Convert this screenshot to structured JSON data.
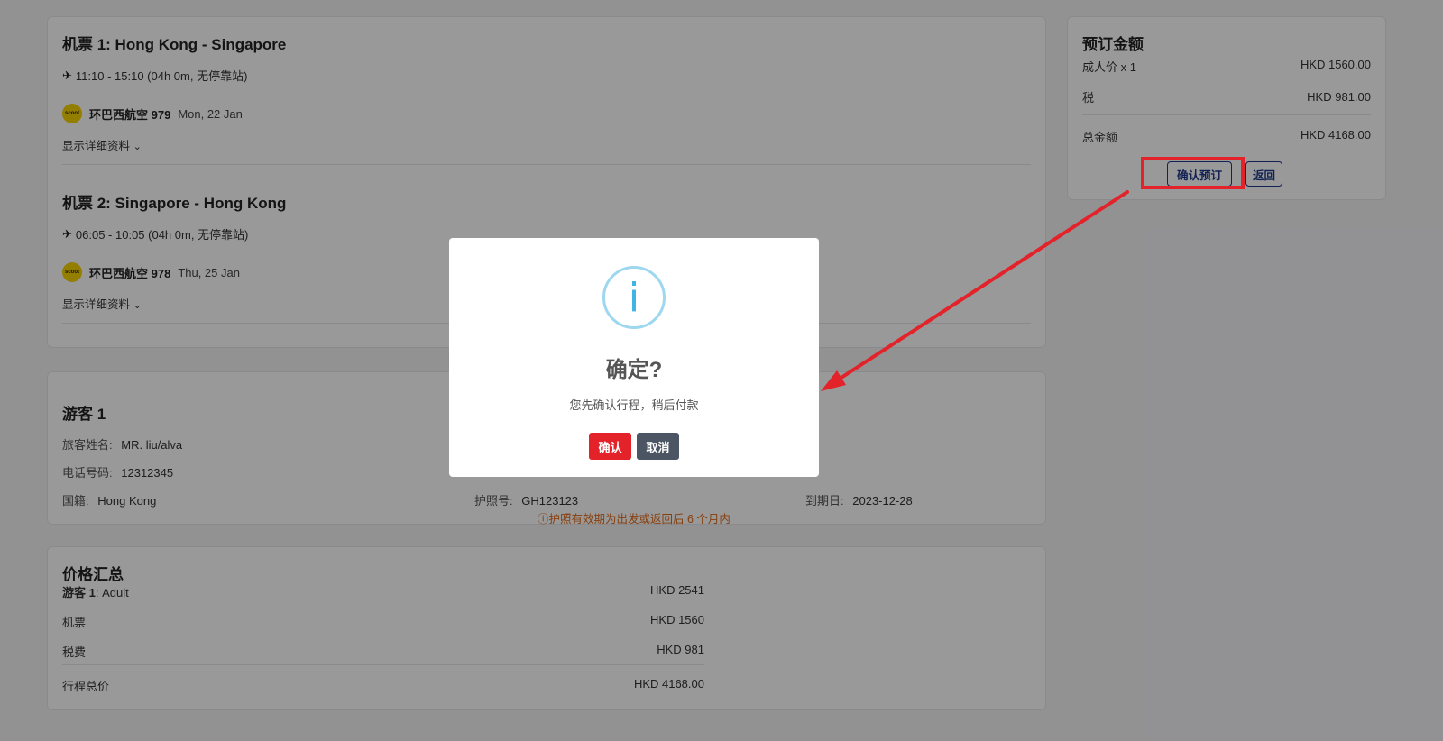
{
  "flights": [
    {
      "title": "机票 1: Hong Kong - Singapore",
      "time": "11:10 - 15:10 (04h 0m, 无停靠站)",
      "airline": "环巴西航空 979",
      "date": "Mon, 22 Jan",
      "details_link": "显示详细资料"
    },
    {
      "title": "机票 2: Singapore - Hong Kong",
      "time": "06:05 - 10:05 (04h 0m, 无停靠站)",
      "airline": "环巴西航空 978",
      "date": "Thu, 25 Jan",
      "details_link": "显示详细资料"
    }
  ],
  "airline_logo_text": "scoot",
  "passenger": {
    "title": "游客 1",
    "name_label": "旅客姓名:",
    "name_value": "MR. liu/alva",
    "phone_label": "电话号码:",
    "phone_value": "12312345",
    "nationality_label": "国籍:",
    "nationality_value": "Hong Kong",
    "passport_label": "护照号:",
    "passport_value": "GH123123",
    "expiry_label": "到期日:",
    "expiry_value": "2023-12-28",
    "warning": "ⓘ护照有效期为出发或返回后 6 个月内"
  },
  "summary": {
    "title": "价格汇总",
    "pax_label_bold": "游客 1",
    "pax_label_rest": ": Adult",
    "pax_value": "HKD 2541",
    "ticket_label": "机票",
    "ticket_value": "HKD 1560",
    "tax_label": "税费",
    "tax_value": "HKD 981",
    "total_label": "行程总价",
    "total_value": "HKD 4168.00"
  },
  "price_panel": {
    "title": "预订金额",
    "adult_label": "成人价 x 1",
    "adult_value": "HKD 1560.00",
    "tax_label": "税",
    "tax_value": "HKD 981.00",
    "total_label": "总金额",
    "total_value": "HKD 4168.00",
    "confirm_button": "确认预订",
    "back_button": "返回"
  },
  "modal": {
    "icon": "info-icon",
    "title": "确定?",
    "text": "您先确认行程，稍后付款",
    "confirm_button": "确认",
    "cancel_button": "取消",
    "confirm_color": "#e3222a",
    "cancel_color": "#4b5563"
  },
  "annotation_color": "#e3222a"
}
